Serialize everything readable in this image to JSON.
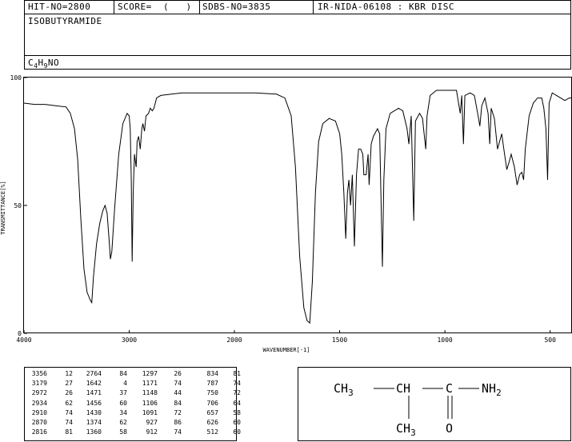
{
  "header": {
    "hit_no": "HIT-NO=2800",
    "score": "SCORE=  (   )",
    "sdbs_no": "SDBS-NO=3835",
    "ir_info": "IR-NIDA-06108 : KBR DISC"
  },
  "compound": {
    "name": "ISOBUTYRAMIDE",
    "formula_parts": [
      "C",
      "4",
      "H",
      "9",
      "NO"
    ]
  },
  "chart_data": {
    "type": "line",
    "xlabel": "WAVENUMBER[-1]",
    "ylabel": "TRANSMITTANCE[%]",
    "xlim": [
      4000,
      400
    ],
    "ylim": [
      0,
      100
    ],
    "x_ticks": [
      4000,
      3000,
      2000,
      1500,
      1000,
      500
    ],
    "y_ticks": [
      0,
      50,
      100
    ],
    "series": [
      {
        "points": [
          [
            4000,
            90
          ],
          [
            3900,
            89.5
          ],
          [
            3800,
            89.5
          ],
          [
            3700,
            89
          ],
          [
            3600,
            88.5
          ],
          [
            3560,
            86
          ],
          [
            3520,
            80
          ],
          [
            3490,
            68
          ],
          [
            3460,
            45
          ],
          [
            3430,
            25
          ],
          [
            3400,
            16
          ],
          [
            3370,
            13
          ],
          [
            3356,
            12
          ],
          [
            3340,
            22
          ],
          [
            3310,
            35
          ],
          [
            3280,
            43
          ],
          [
            3250,
            48
          ],
          [
            3230,
            50
          ],
          [
            3210,
            47
          ],
          [
            3190,
            36
          ],
          [
            3179,
            29
          ],
          [
            3165,
            32
          ],
          [
            3140,
            48
          ],
          [
            3100,
            70
          ],
          [
            3060,
            82
          ],
          [
            3020,
            86
          ],
          [
            3000,
            85
          ],
          [
            2990,
            80
          ],
          [
            2980,
            60
          ],
          [
            2972,
            28
          ],
          [
            2962,
            55
          ],
          [
            2950,
            70
          ],
          [
            2934,
            65
          ],
          [
            2925,
            75
          ],
          [
            2910,
            77
          ],
          [
            2895,
            72
          ],
          [
            2880,
            80
          ],
          [
            2870,
            82
          ],
          [
            2855,
            79
          ],
          [
            2840,
            85
          ],
          [
            2816,
            86
          ],
          [
            2800,
            88
          ],
          [
            2780,
            87
          ],
          [
            2764,
            88
          ],
          [
            2740,
            92
          ],
          [
            2700,
            93
          ],
          [
            2600,
            93.5
          ],
          [
            2500,
            94
          ],
          [
            2400,
            94
          ],
          [
            2300,
            94
          ],
          [
            2200,
            94
          ],
          [
            2100,
            94
          ],
          [
            2000,
            94
          ],
          [
            1900,
            94
          ],
          [
            1800,
            93.5
          ],
          [
            1760,
            92
          ],
          [
            1730,
            85
          ],
          [
            1710,
            65
          ],
          [
            1690,
            30
          ],
          [
            1670,
            10
          ],
          [
            1655,
            5
          ],
          [
            1642,
            4
          ],
          [
            1630,
            20
          ],
          [
            1615,
            55
          ],
          [
            1600,
            75
          ],
          [
            1580,
            82
          ],
          [
            1550,
            84
          ],
          [
            1520,
            83
          ],
          [
            1500,
            78
          ],
          [
            1490,
            70
          ],
          [
            1480,
            55
          ],
          [
            1471,
            37
          ],
          [
            1463,
            55
          ],
          [
            1456,
            60
          ],
          [
            1448,
            50
          ],
          [
            1440,
            62
          ],
          [
            1430,
            34
          ],
          [
            1420,
            62
          ],
          [
            1410,
            72
          ],
          [
            1400,
            72
          ],
          [
            1390,
            70
          ],
          [
            1385,
            62
          ],
          [
            1374,
            62
          ],
          [
            1365,
            70
          ],
          [
            1360,
            58
          ],
          [
            1350,
            74
          ],
          [
            1340,
            77
          ],
          [
            1320,
            80
          ],
          [
            1310,
            78
          ],
          [
            1297,
            26
          ],
          [
            1290,
            60
          ],
          [
            1280,
            80
          ],
          [
            1260,
            86
          ],
          [
            1220,
            88
          ],
          [
            1200,
            87
          ],
          [
            1180,
            80
          ],
          [
            1171,
            74
          ],
          [
            1160,
            85
          ],
          [
            1148,
            44
          ],
          [
            1140,
            83
          ],
          [
            1120,
            86
          ],
          [
            1106,
            84
          ],
          [
            1100,
            79
          ],
          [
            1091,
            72
          ],
          [
            1085,
            85
          ],
          [
            1070,
            93
          ],
          [
            1040,
            95
          ],
          [
            1000,
            95
          ],
          [
            970,
            95
          ],
          [
            945,
            95
          ],
          [
            935,
            90
          ],
          [
            927,
            86
          ],
          [
            920,
            93
          ],
          [
            912,
            74
          ],
          [
            905,
            93
          ],
          [
            880,
            94
          ],
          [
            860,
            93
          ],
          [
            840,
            84
          ],
          [
            834,
            81
          ],
          [
            825,
            89
          ],
          [
            810,
            92
          ],
          [
            795,
            86
          ],
          [
            787,
            74
          ],
          [
            780,
            88
          ],
          [
            765,
            84
          ],
          [
            750,
            72
          ],
          [
            740,
            75
          ],
          [
            730,
            78
          ],
          [
            720,
            72
          ],
          [
            706,
            64
          ],
          [
            695,
            67
          ],
          [
            685,
            70
          ],
          [
            670,
            65
          ],
          [
            657,
            58
          ],
          [
            645,
            62
          ],
          [
            635,
            63
          ],
          [
            626,
            60
          ],
          [
            618,
            72
          ],
          [
            600,
            85
          ],
          [
            580,
            90
          ],
          [
            560,
            92
          ],
          [
            540,
            92
          ],
          [
            530,
            88
          ],
          [
            520,
            80
          ],
          [
            512,
            60
          ],
          [
            505,
            90
          ],
          [
            490,
            94
          ],
          [
            470,
            93
          ],
          [
            450,
            92
          ],
          [
            430,
            91
          ],
          [
            410,
            92
          ],
          [
            400,
            92
          ]
        ]
      }
    ],
    "peak_table": [
      [
        "3356",
        "12",
        "2764",
        "84",
        "1297",
        "26",
        "834",
        "81"
      ],
      [
        "3179",
        "27",
        "1642",
        "4",
        "1171",
        "74",
        "787",
        "74"
      ],
      [
        "2972",
        "26",
        "1471",
        "37",
        "1148",
        "44",
        "750",
        "72"
      ],
      [
        "2934",
        "62",
        "1456",
        "60",
        "1106",
        "84",
        "706",
        "64"
      ],
      [
        "2910",
        "74",
        "1430",
        "34",
        "1091",
        "72",
        "657",
        "58"
      ],
      [
        "2870",
        "74",
        "1374",
        "62",
        "927",
        "86",
        "626",
        "60"
      ],
      [
        "2816",
        "81",
        "1360",
        "58",
        "912",
        "74",
        "512",
        "60"
      ]
    ]
  },
  "structure": {
    "ch3_left": "CH",
    "ch3_left_sub": "3",
    "ch": "CH",
    "c": "C",
    "nh2": "NH",
    "nh2_sub": "2",
    "ch3_bottom": "CH",
    "ch3_bottom_sub": "3",
    "o": "O"
  }
}
